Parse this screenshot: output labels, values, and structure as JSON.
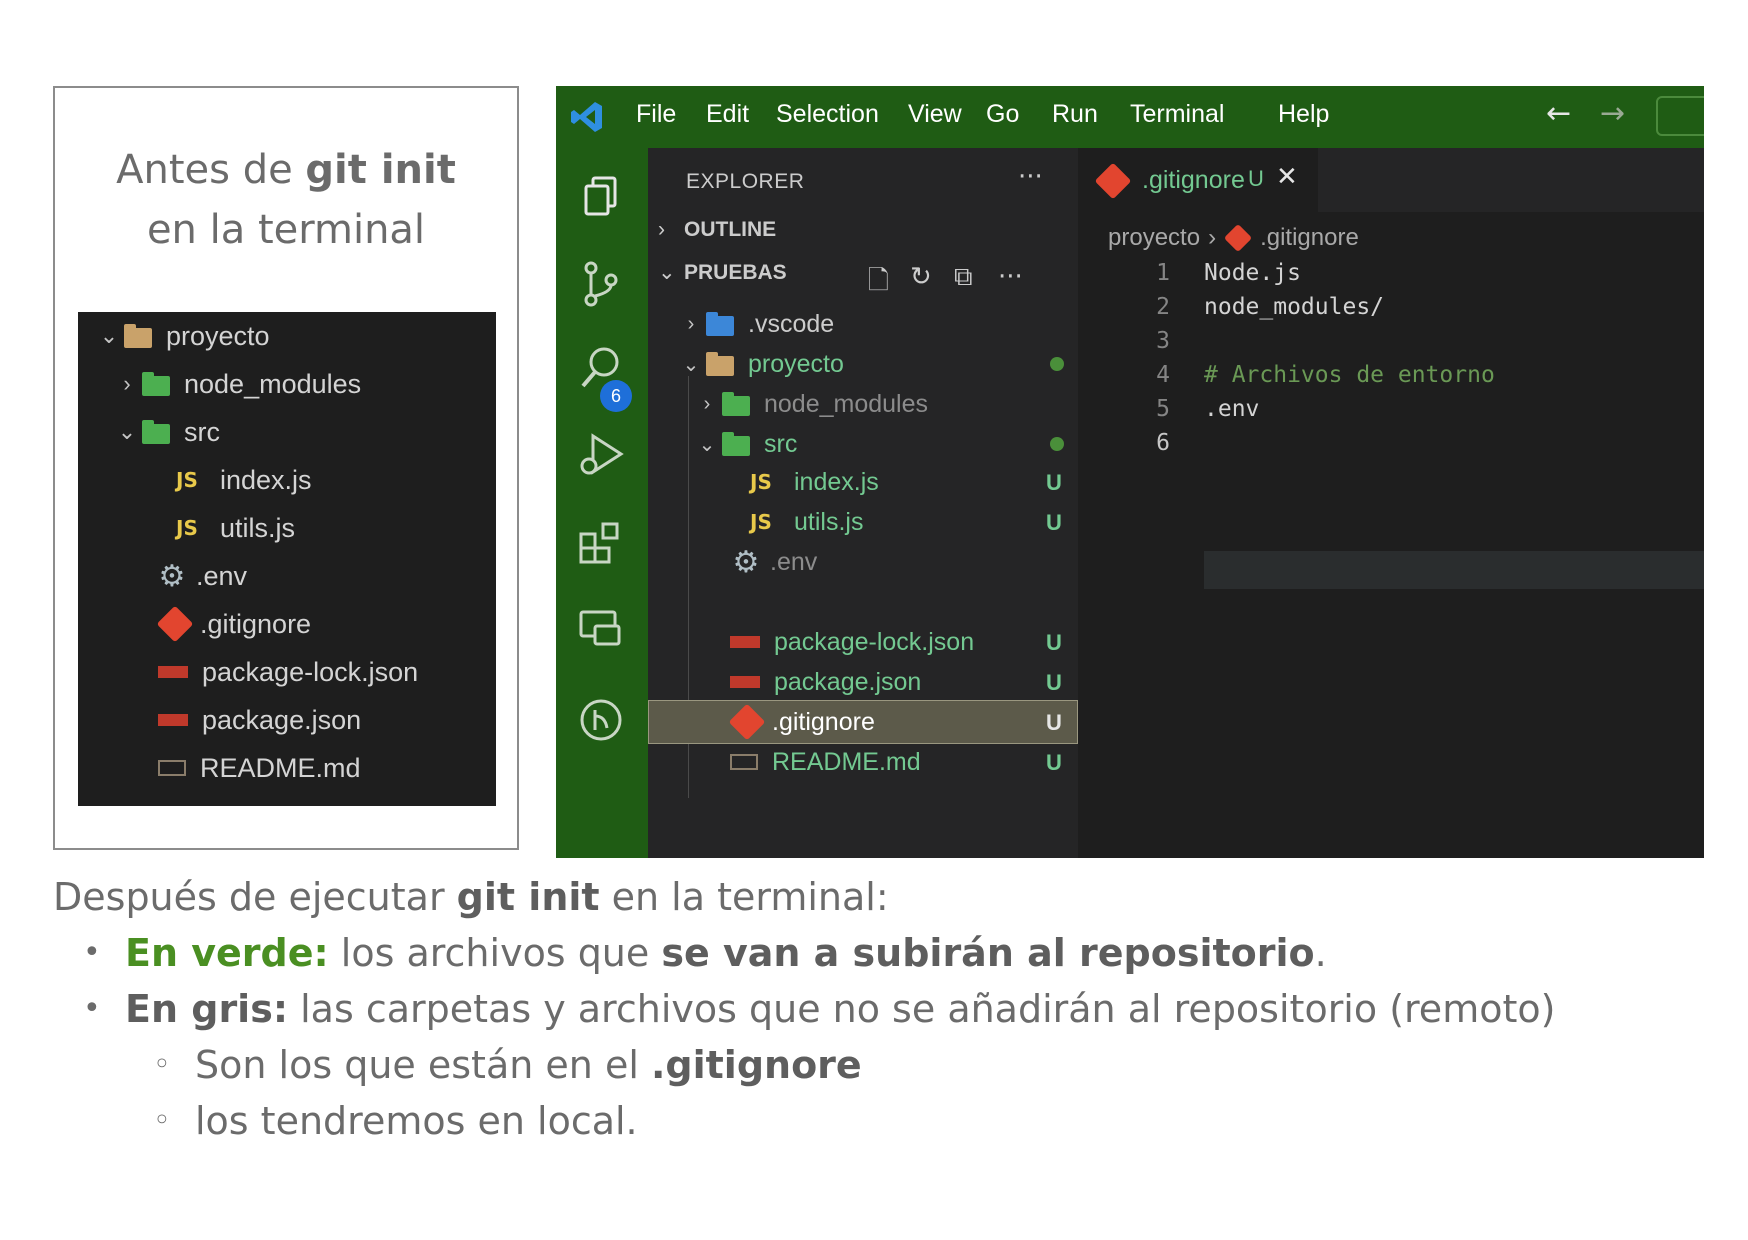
{
  "before_panel": {
    "caption_pre": "Antes de ",
    "caption_bold": "git init",
    "caption_line2": "en la terminal",
    "tree": [
      {
        "label": "proyecto",
        "twisty": "⌄",
        "icon": "folder-open-icon"
      },
      {
        "label": "node_modules",
        "twisty": "›",
        "icon": "node-folder-icon"
      },
      {
        "label": "src",
        "twisty": "⌄",
        "icon": "src-folder-icon"
      },
      {
        "label": "index.js",
        "icon": "js-icon",
        "icon_text": "JS"
      },
      {
        "label": "utils.js",
        "icon": "js-icon",
        "icon_text": "JS"
      },
      {
        "label": ".env",
        "icon": "gear-icon"
      },
      {
        "label": ".gitignore",
        "icon": "git-icon"
      },
      {
        "label": "package-lock.json",
        "icon": "npm-icon"
      },
      {
        "label": "package.json",
        "icon": "npm-icon"
      },
      {
        "label": "README.md",
        "icon": "markdown-icon"
      }
    ]
  },
  "vscode": {
    "menu": [
      "File",
      "Edit",
      "Selection",
      "View",
      "Go",
      "Run",
      "Terminal",
      "Help"
    ],
    "scm_badge": "6",
    "explorer_title": "EXPLORER",
    "outline_label": "OUTLINE",
    "workspace_label": "PRUEBAS",
    "tree": [
      {
        "label": ".vscode",
        "twisty": "›",
        "icon": "vscode-folder-icon",
        "color": "#cccccc"
      },
      {
        "label": "proyecto",
        "twisty": "⌄",
        "icon": "folder-open-icon",
        "color": "#73c991",
        "dot": true
      },
      {
        "label": "node_modules",
        "twisty": "›",
        "icon": "node-folder-icon",
        "color": "#8c8c8c"
      },
      {
        "label": "src",
        "twisty": "⌄",
        "icon": "src-folder-icon",
        "color": "#73c991",
        "dot": true
      },
      {
        "label": "index.js",
        "icon": "js-icon",
        "icon_text": "JS",
        "color": "#73c991",
        "status": "U"
      },
      {
        "label": "utils.js",
        "icon": "js-icon",
        "icon_text": "JS",
        "color": "#73c991",
        "status": "U"
      },
      {
        "label": ".env",
        "icon": "gear-icon",
        "color": "#8c8c8c"
      },
      {
        "label": ".gitignore",
        "icon": "git-icon",
        "color": "#ffffff",
        "status": "U",
        "selected": true
      },
      {
        "label": "package-lock.json",
        "icon": "npm-icon",
        "color": "#73c991",
        "status": "U"
      },
      {
        "label": "package.json",
        "icon": "npm-icon",
        "color": "#73c991",
        "status": "U"
      },
      {
        "label": "README.md",
        "icon": "markdown-icon",
        "color": "#73c991",
        "status": "U"
      }
    ],
    "tab": {
      "label": ".gitignore",
      "status": "U"
    },
    "breadcrumb": {
      "folder": "proyecto",
      "separator": "›",
      "file": ".gitignore"
    },
    "code_lines": [
      {
        "num": "1",
        "text": "Node.js"
      },
      {
        "num": "2",
        "text": "node_modules/"
      },
      {
        "num": "3",
        "text": ""
      },
      {
        "num": "4",
        "text": "# Archivos de entorno",
        "comment": true
      },
      {
        "num": "5",
        "text": ".env"
      },
      {
        "num": "6",
        "text": ""
      }
    ],
    "colors": {
      "titlebar": "#1f5c14",
      "untracked": "#73c991",
      "ignored": "#8c8c8c"
    }
  },
  "bottom": {
    "intro_pre": "Después de ejecutar ",
    "intro_bold": "git init",
    "intro_post": " en la terminal:",
    "b1_label": "En verde:",
    "b1_text": " los archivos que ",
    "b1_bold": "se van a subirán al repositorio",
    "b1_end": ".",
    "b2_label": "En gris:",
    "b2_text": " las carpetas y archivos que no se añadirán al repositorio (remoto)",
    "sub1_pre": "Son los que están en el ",
    "sub1_bold": ".gitignore",
    "sub2": "los tendremos en local.",
    "bullet": "•",
    "sub_bullet": "◦"
  }
}
